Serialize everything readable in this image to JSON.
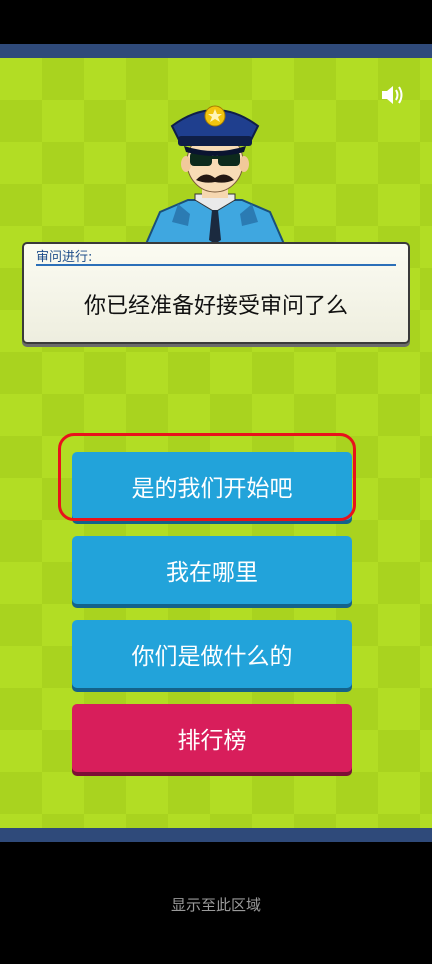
{
  "screen": {
    "dialog": {
      "header": "审问进行:",
      "text": "你已经准备好接受审问了么"
    },
    "buttons": [
      {
        "label": "是的我们开始吧",
        "color": "#22a3da",
        "highlighted": true
      },
      {
        "label": "我在哪里",
        "color": "#22a3da"
      },
      {
        "label": "你们是做什么的",
        "color": "#22a3da"
      },
      {
        "label": "排行榜",
        "color": "#d81e5b"
      }
    ],
    "sound_icon": "speaker-icon",
    "character": "police-officer"
  },
  "footer": {
    "text": "显示至此区域"
  },
  "colors": {
    "background": "#b2dd24",
    "bar": "#2f4a7a",
    "button_blue": "#22a3da",
    "button_red": "#d81e5b",
    "highlight": "#e8121b"
  }
}
